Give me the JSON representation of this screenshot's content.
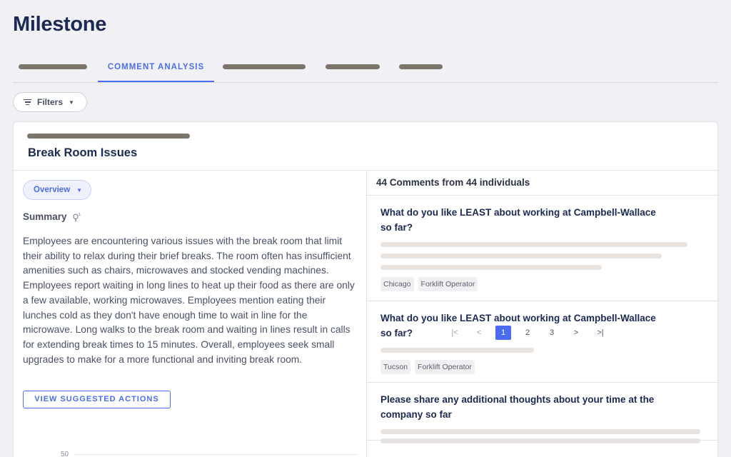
{
  "app": {
    "title": "Milestone"
  },
  "tabs": {
    "active_label": "COMMENT ANALYSIS"
  },
  "toolbar": {
    "filters_label": "Filters"
  },
  "card": {
    "title": "Break Room Issues",
    "overview_label": "Overview",
    "summary_label": "Summary",
    "summary_text": "Employees are encountering various issues with the break room that limit their ability to relax during their brief breaks. The room often has insufficient amenities such as chairs, microwaves and stocked vending machines. Employees report waiting in long lines to heat up their food as there are only a few available, working microwaves. Employees mention eating their lunches cold as they don't have enough time to wait in line for the microwave. Long walks to the break room and waiting in lines result in calls for extending break times to 15 minutes. Overall, employees seek small upgrades to make for a more functional and inviting break room.",
    "actions_label": "VIEW SUGGESTED ACTIONS",
    "axis_tick": "50"
  },
  "comments": {
    "count_label": "44 Comments from 44 individuals",
    "items": [
      {
        "question": "What do you like LEAST about working at Campbell-Wallace so far?",
        "tags": [
          "Chicago",
          "Forklift Operator"
        ]
      },
      {
        "question": "What do you like LEAST about working at Campbell-Wallace so far?",
        "tags": [
          "Tucson",
          "Forklift Operator"
        ]
      },
      {
        "question": "Please share any additional thoughts about your time at the company so far",
        "tags": []
      }
    ]
  },
  "pagination": {
    "first": "|<",
    "prev": "<",
    "next": ">",
    "last": ">|",
    "pages": [
      "1",
      "2",
      "3"
    ],
    "current": "1"
  },
  "colors": {
    "accent": "#4a6cf0",
    "title": "#1b2a55",
    "placeholder_dark": "#7b756c",
    "placeholder_light": "#e8e3de"
  },
  "icons": [
    "filter-icon",
    "caret-down-icon",
    "lightbulb-icon"
  ]
}
